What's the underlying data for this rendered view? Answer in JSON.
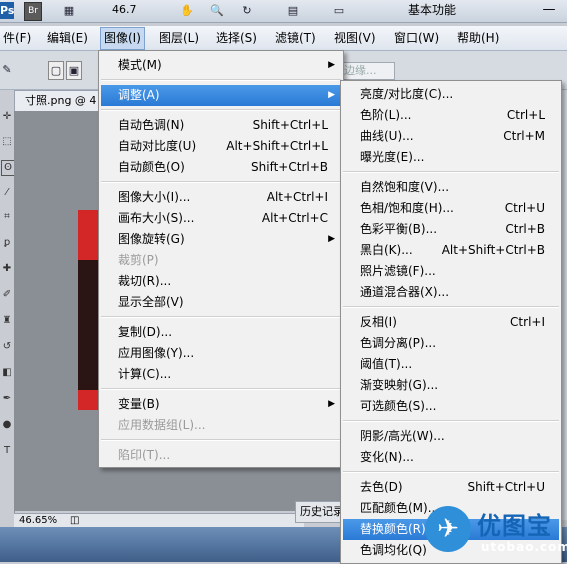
{
  "app_bar": {
    "logo": "Ps",
    "bridge": "Br",
    "zoom": "46.7",
    "workspace": "基本功能",
    "minimize": "—",
    "maximize": "□"
  },
  "menubar": {
    "items": [
      "件(F)",
      "编辑(E)",
      "图像(I)",
      "图层(L)",
      "选择(S)",
      "滤镜(T)",
      "视图(V)",
      "窗口(W)",
      "帮助(H)"
    ],
    "active_index": 2
  },
  "options_bar": {
    "search_placeholder": "边缘..."
  },
  "document": {
    "tab_title": "寸照.png @ 4",
    "zoom_percent": "46.65%",
    "history_tab": "历史记录"
  },
  "image_menu": {
    "items": [
      {
        "label": "模式(M)",
        "shortcut": "",
        "submenu": true,
        "disabled": false
      },
      {
        "sep": true
      },
      {
        "label": "调整(A)",
        "shortcut": "",
        "submenu": true,
        "disabled": false,
        "highlighted": true
      },
      {
        "sep": true
      },
      {
        "label": "自动色调(N)",
        "shortcut": "Shift+Ctrl+L",
        "submenu": false,
        "disabled": false
      },
      {
        "label": "自动对比度(U)",
        "shortcut": "Alt+Shift+Ctrl+L",
        "submenu": false,
        "disabled": false
      },
      {
        "label": "自动颜色(O)",
        "shortcut": "Shift+Ctrl+B",
        "submenu": false,
        "disabled": false
      },
      {
        "sep": true
      },
      {
        "label": "图像大小(I)...",
        "shortcut": "Alt+Ctrl+I",
        "submenu": false,
        "disabled": false
      },
      {
        "label": "画布大小(S)...",
        "shortcut": "Alt+Ctrl+C",
        "submenu": false,
        "disabled": false
      },
      {
        "label": "图像旋转(G)",
        "shortcut": "",
        "submenu": true,
        "disabled": false
      },
      {
        "label": "裁剪(P)",
        "shortcut": "",
        "submenu": false,
        "disabled": true
      },
      {
        "label": "裁切(R)...",
        "shortcut": "",
        "submenu": false,
        "disabled": false
      },
      {
        "label": "显示全部(V)",
        "shortcut": "",
        "submenu": false,
        "disabled": false
      },
      {
        "sep": true
      },
      {
        "label": "复制(D)...",
        "shortcut": "",
        "submenu": false,
        "disabled": false
      },
      {
        "label": "应用图像(Y)...",
        "shortcut": "",
        "submenu": false,
        "disabled": false
      },
      {
        "label": "计算(C)...",
        "shortcut": "",
        "submenu": false,
        "disabled": false
      },
      {
        "sep": true
      },
      {
        "label": "变量(B)",
        "shortcut": "",
        "submenu": true,
        "disabled": false
      },
      {
        "label": "应用数据组(L)...",
        "shortcut": "",
        "submenu": false,
        "disabled": true
      },
      {
        "sep": true
      },
      {
        "label": "陷印(T)...",
        "shortcut": "",
        "submenu": false,
        "disabled": true
      }
    ]
  },
  "adjust_menu": {
    "items": [
      {
        "label": "亮度/对比度(C)...",
        "shortcut": ""
      },
      {
        "label": "色阶(L)...",
        "shortcut": "Ctrl+L"
      },
      {
        "label": "曲线(U)...",
        "shortcut": "Ctrl+M"
      },
      {
        "label": "曝光度(E)...",
        "shortcut": ""
      },
      {
        "sep": true
      },
      {
        "label": "自然饱和度(V)...",
        "shortcut": ""
      },
      {
        "label": "色相/饱和度(H)...",
        "shortcut": "Ctrl+U"
      },
      {
        "label": "色彩平衡(B)...",
        "shortcut": "Ctrl+B"
      },
      {
        "label": "黑白(K)...",
        "shortcut": "Alt+Shift+Ctrl+B"
      },
      {
        "label": "照片滤镜(F)...",
        "shortcut": ""
      },
      {
        "label": "通道混合器(X)...",
        "shortcut": ""
      },
      {
        "sep": true
      },
      {
        "label": "反相(I)",
        "shortcut": "Ctrl+I"
      },
      {
        "label": "色调分离(P)...",
        "shortcut": ""
      },
      {
        "label": "阈值(T)...",
        "shortcut": ""
      },
      {
        "label": "渐变映射(G)...",
        "shortcut": ""
      },
      {
        "label": "可选颜色(S)...",
        "shortcut": ""
      },
      {
        "sep": true
      },
      {
        "label": "阴影/高光(W)...",
        "shortcut": ""
      },
      {
        "label": "变化(N)...",
        "shortcut": ""
      },
      {
        "sep": true
      },
      {
        "label": "去色(D)",
        "shortcut": "Shift+Ctrl+U"
      },
      {
        "label": "匹配颜色(M)...",
        "shortcut": ""
      },
      {
        "label": "替换颜色(R)...",
        "shortcut": "",
        "highlighted": true
      },
      {
        "label": "色调均化(Q)",
        "shortcut": ""
      }
    ]
  },
  "watermark": {
    "cn": "优图宝",
    "en": "utobao.com"
  },
  "colors": {
    "highlight": "#2a7ad6",
    "menu_bg": "#f1f1f1",
    "disabled": "#9a9a9a"
  }
}
